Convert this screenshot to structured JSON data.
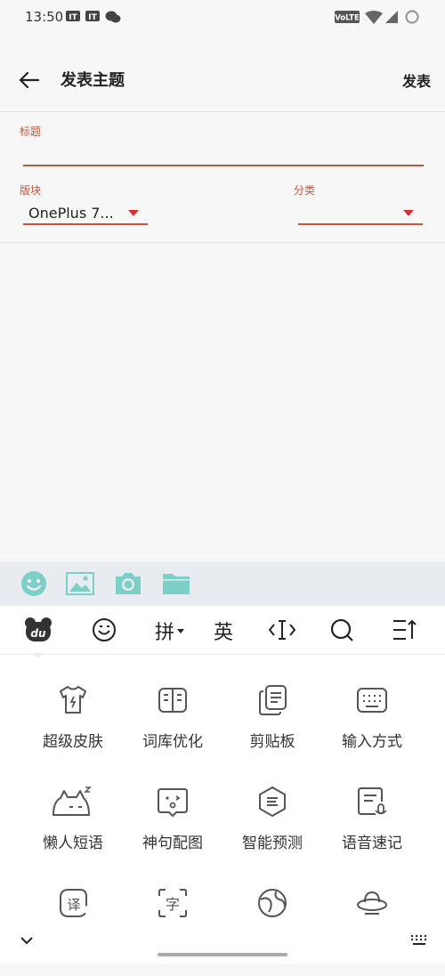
{
  "status_bar": {
    "time": "13:50",
    "volte": "VoLTE"
  },
  "header": {
    "title": "发表主题",
    "publish_label": "发表"
  },
  "form": {
    "title_label": "标题",
    "title_value": "",
    "board_label": "版块",
    "board_value": "OnePlus 7...",
    "category_label": "分类",
    "category_value": ""
  },
  "attachments": [
    "emoji-icon",
    "image-icon",
    "camera-icon",
    "folder-icon"
  ],
  "keyboard": {
    "toolbar": {
      "pinyin": "拼",
      "english": "英"
    },
    "tiles": [
      {
        "label": "超级皮肤"
      },
      {
        "label": "词库优化"
      },
      {
        "label": "剪贴板"
      },
      {
        "label": "输入方式"
      },
      {
        "label": "懒人短语"
      },
      {
        "label": "神句配图"
      },
      {
        "label": "智能预测"
      },
      {
        "label": "语音速记"
      },
      {
        "label": ""
      },
      {
        "label": ""
      },
      {
        "label": ""
      },
      {
        "label": ""
      }
    ]
  },
  "colors": {
    "accent": "#c0573b",
    "attach": "#7ccfc6",
    "triangle": "#d32f2f"
  }
}
